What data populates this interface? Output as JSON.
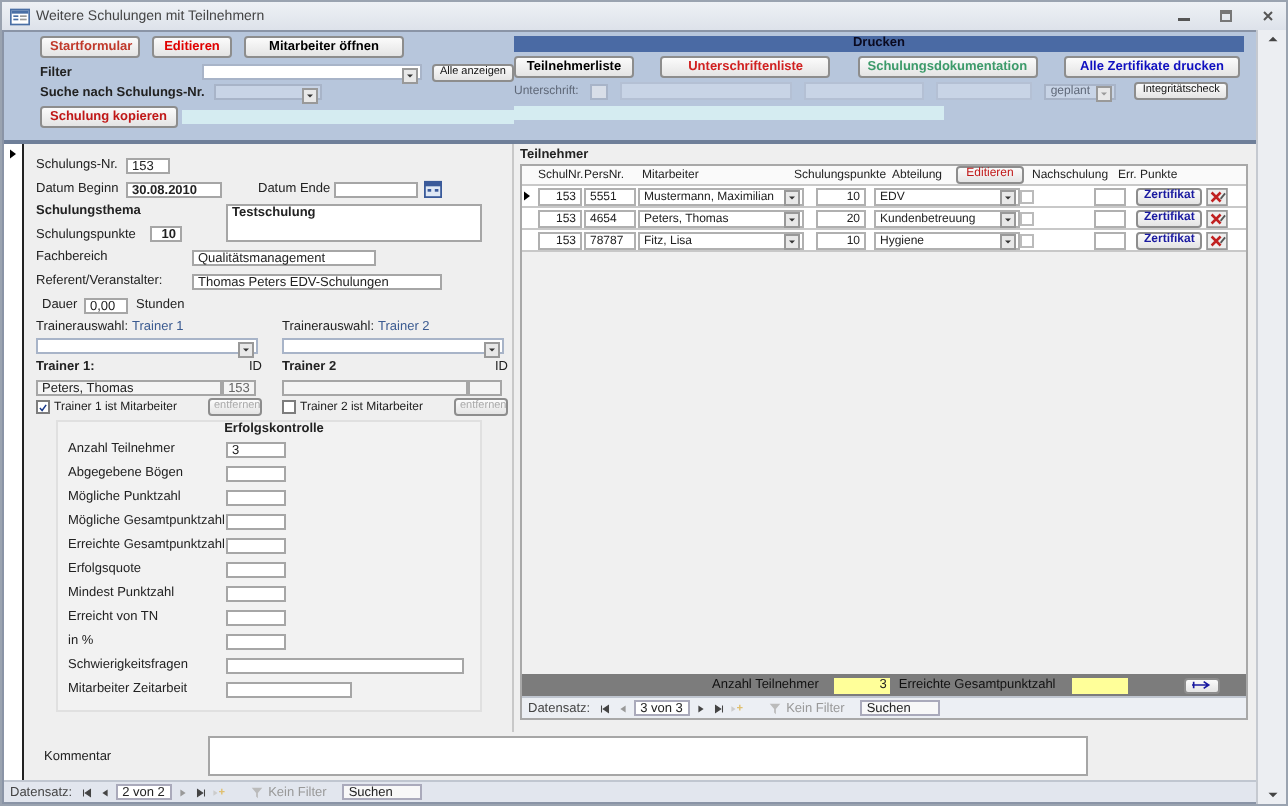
{
  "window": {
    "title": "Weitere Schulungen mit Teilnehmern"
  },
  "header": {
    "buttons": [
      {
        "label": "Startformular",
        "color": "#c0392b"
      },
      {
        "label": "Editieren",
        "color": "#e00000"
      },
      {
        "label": "Mitarbeiter öffnen",
        "color": "#000000"
      }
    ],
    "filter": {
      "label": "Filter",
      "button": "Alle anzeigen"
    },
    "search": {
      "label": "Suche nach Schulungs-Nr."
    },
    "copy_button": "Schulung kopieren"
  },
  "print": {
    "title": "Drucken",
    "buttons": [
      {
        "label": "Teilnehmerliste",
        "color": "#000000"
      },
      {
        "label": "Unterschriftenliste",
        "color": "#d02020"
      },
      {
        "label": "Schulungsdokumentation",
        "color": "#3c9a6a"
      },
      {
        "label": "Alle Zertifikate drucken",
        "color": "#1010c0"
      }
    ],
    "signature_label": "Unterschrift:",
    "status": "geplant",
    "check_button": "Integritätscheck"
  },
  "form": {
    "nr": {
      "label": "Schulungs-Nr.",
      "value": "153"
    },
    "start": {
      "label": "Datum Beginn",
      "value": "30.08.2010"
    },
    "end": {
      "label": "Datum Ende"
    },
    "topic": {
      "label": "Schulungsthema",
      "value": "Testschulung"
    },
    "points": {
      "label": "Schulungspunkte",
      "value": "10"
    },
    "area": {
      "label": "Fachbereich",
      "value": "Qualitätsmanagement"
    },
    "speaker": {
      "label": "Referent/Veranstalter:",
      "value": "Thomas Peters EDV-Schulungen"
    },
    "duration": {
      "label": "Dauer",
      "value": "0,00",
      "unit": "Stunden"
    },
    "trainers": [
      {
        "select_label": "Trainerauswahl:",
        "select_value": "Trainer 1",
        "heading": "Trainer 1:",
        "id_label": "ID",
        "name": "Peters, Thomas",
        "id": "153",
        "employee_label": "Trainer 1 ist Mitarbeiter",
        "is_employee": true,
        "remove_button": "entfernen",
        "remove_disabled": true
      },
      {
        "select_label": "Trainerauswahl:",
        "select_value": "Trainer 2",
        "heading": "Trainer 2",
        "id_label": "ID",
        "employee_label": "Trainer 2 ist Mitarbeiter",
        "is_employee": false,
        "remove_button": "entfernen",
        "remove_disabled": true
      }
    ],
    "success": {
      "title": "Erfolgskontrolle",
      "fields": [
        {
          "label": "Anzahl Teilnehmer",
          "value": "3",
          "kind": "short"
        },
        {
          "label": "Abgegebene Bögen",
          "kind": "short"
        },
        {
          "label": "Mögliche Punktzahl",
          "kind": "short"
        },
        {
          "label": "Mögliche Gesamtpunktzahl",
          "kind": "short"
        },
        {
          "label": "Erreichte Gesamtpunktzahl",
          "kind": "short"
        },
        {
          "label": "Erfolgsquote",
          "kind": "short"
        },
        {
          "label": "Mindest Punktzahl",
          "kind": "short"
        },
        {
          "label": "Erreicht von TN",
          "kind": "short"
        },
        {
          "label": "in %",
          "kind": "short"
        },
        {
          "label": "Schwierigkeitsfragen",
          "kind": "wide"
        },
        {
          "label": "Mitarbeiter Zeitarbeit",
          "kind": "medium"
        }
      ]
    },
    "comment": {
      "label": "Kommentar"
    },
    "nav": {
      "label": "Datensatz:",
      "position": "2 von 2",
      "filter": "Kein Filter",
      "search": "Suchen"
    }
  },
  "subform": {
    "title": "Teilnehmer",
    "columns": [
      "SchulNr.",
      "PersNr.",
      "Mitarbeiter",
      "Schulungspunkte",
      "Abteilung",
      "Nachschulung",
      "Err. Punkte"
    ],
    "edit_button": "Editieren",
    "rows": [
      {
        "nr": "153",
        "pers": "5551",
        "name": "Mustermann, Maximilian",
        "points": "10",
        "dept": "EDV",
        "retraining": false,
        "current": true,
        "certificate": "Zertifikat"
      },
      {
        "nr": "153",
        "pers": "4654",
        "name": "Peters, Thomas",
        "points": "20",
        "dept": "Kundenbetreuung",
        "retraining": false,
        "current": false,
        "certificate": "Zertifikat"
      },
      {
        "nr": "153",
        "pers": "78787",
        "name": "Fitz, Lisa",
        "points": "10",
        "dept": "Hygiene",
        "retraining": false,
        "current": false,
        "certificate": "Zertifikat"
      }
    ],
    "footer": {
      "count_label": "Anzahl Teilnehmer",
      "count": "3",
      "total_label": "Erreichte Gesamtpunktzahl"
    },
    "nav": {
      "label": "Datensatz:",
      "position": "3 von 3",
      "filter": "Kein Filter",
      "search": "Suchen"
    }
  }
}
